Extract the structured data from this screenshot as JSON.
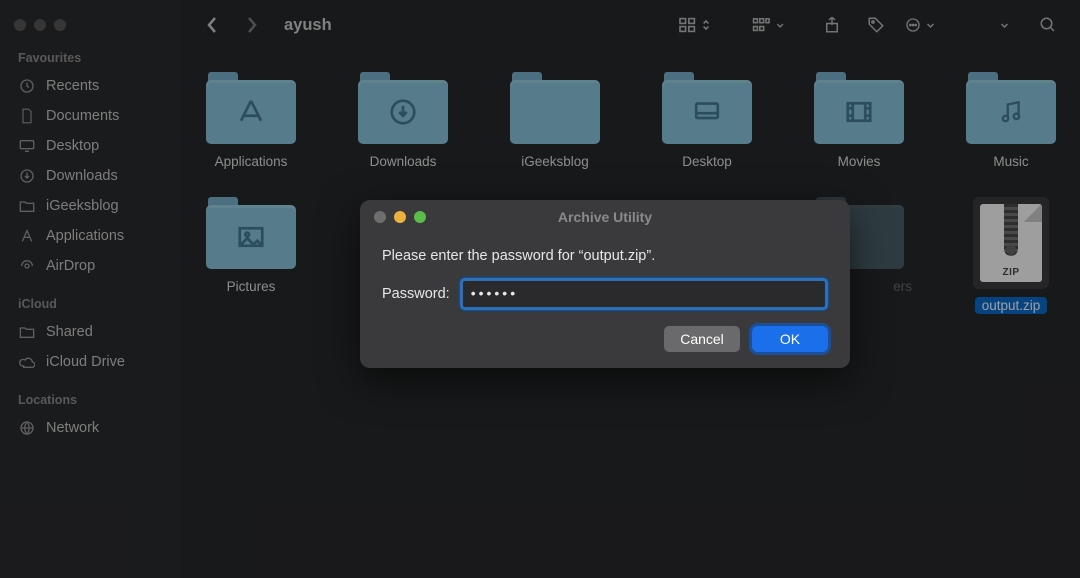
{
  "window": {
    "title": "ayush"
  },
  "sidebar": {
    "sections": [
      {
        "title": "Favourites",
        "items": [
          {
            "label": "Recents",
            "icon": "clock-icon"
          },
          {
            "label": "Documents",
            "icon": "document-icon"
          },
          {
            "label": "Desktop",
            "icon": "desktop-icon"
          },
          {
            "label": "Downloads",
            "icon": "download-circle-icon"
          },
          {
            "label": "iGeeksblog",
            "icon": "folder-icon"
          },
          {
            "label": "Applications",
            "icon": "a-letter-icon"
          },
          {
            "label": "AirDrop",
            "icon": "airdrop-icon"
          }
        ]
      },
      {
        "title": "iCloud",
        "items": [
          {
            "label": "Shared",
            "icon": "shared-folder-icon"
          },
          {
            "label": "iCloud Drive",
            "icon": "cloud-icon"
          }
        ]
      },
      {
        "title": "Locations",
        "items": [
          {
            "label": "Network",
            "icon": "globe-icon"
          }
        ]
      }
    ]
  },
  "grid": {
    "row1": [
      {
        "label": "Applications",
        "glyph": "app"
      },
      {
        "label": "Downloads",
        "glyph": "down"
      },
      {
        "label": "iGeeksblog",
        "glyph": "none"
      },
      {
        "label": "Desktop",
        "glyph": "desk"
      },
      {
        "label": "Movies",
        "glyph": "film"
      },
      {
        "label": "Music",
        "glyph": "music"
      }
    ],
    "row2": [
      {
        "label": "Pictures",
        "glyph": "pic"
      }
    ],
    "hidden_folder_suffix": "ers",
    "file": {
      "label": "output.zip",
      "ext": "ZIP",
      "selected": true
    }
  },
  "dialog": {
    "title": "Archive Utility",
    "message": "Please enter the password for “output.zip”.",
    "password_label": "Password:",
    "password_value": "••••••",
    "cancel": "Cancel",
    "ok": "OK"
  }
}
